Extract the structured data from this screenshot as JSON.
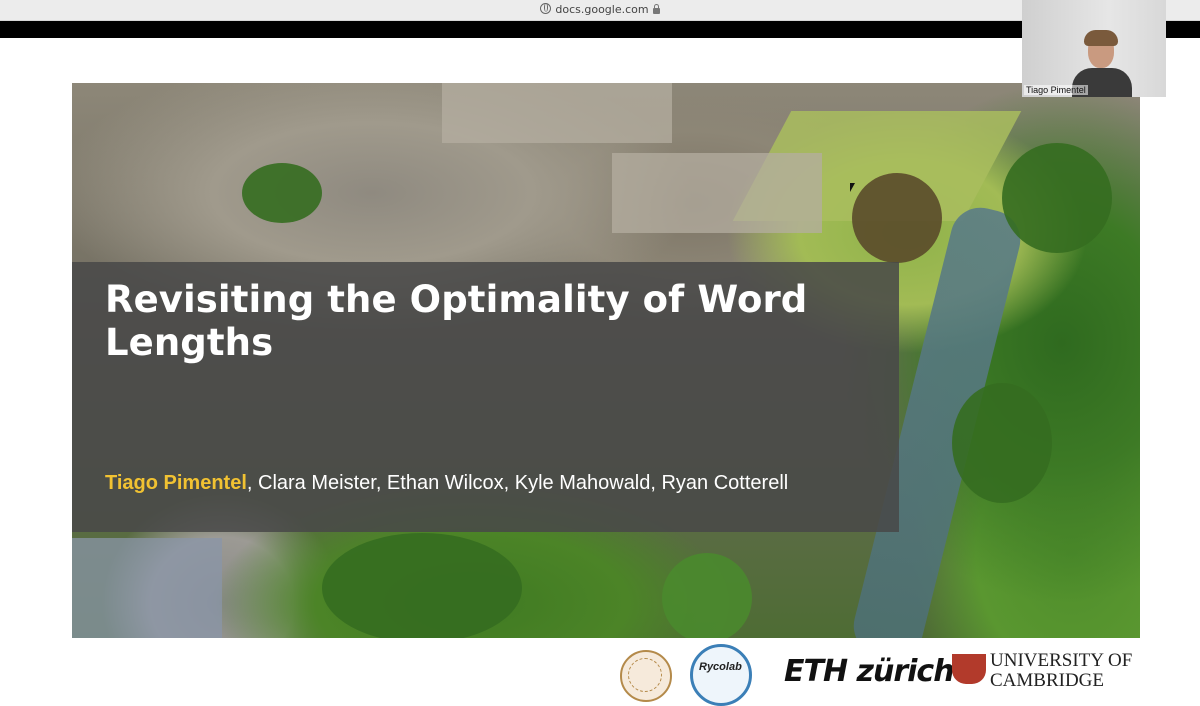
{
  "browser": {
    "url": "docs.google.com"
  },
  "slide": {
    "title": "Revisiting the Optimality of Word Lengths",
    "authors_first": "Tiago Pimentel",
    "authors_rest": ", Clara Meister, Ethan Wilcox, Kyle Mahowald, Ryan Cotterell"
  },
  "webcam": {
    "participant_name": "Tiago Pimentel"
  },
  "logos": {
    "rycolab": "Rycolab",
    "eth": "ETH zürich",
    "cambridge_line1": "UNIVERSITY OF",
    "cambridge_line2": "CAMBRIDGE"
  },
  "colors": {
    "title_box": "#484848",
    "first_author": "#f1c232"
  }
}
